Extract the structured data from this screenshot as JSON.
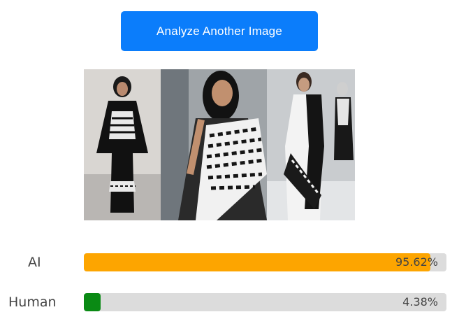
{
  "action": {
    "analyze_label": "Analyze Another Image"
  },
  "image": {
    "subject": "runway fashion photo - three models in black and white keffiyeh-pattern garments"
  },
  "results": [
    {
      "label": "AI",
      "value_text": "95.62%",
      "fraction": 0.9562,
      "color": "#fda500"
    },
    {
      "label": "Human",
      "value_text": "4.38%",
      "fraction": 0.0438,
      "color": "#0a8a14"
    }
  ]
}
